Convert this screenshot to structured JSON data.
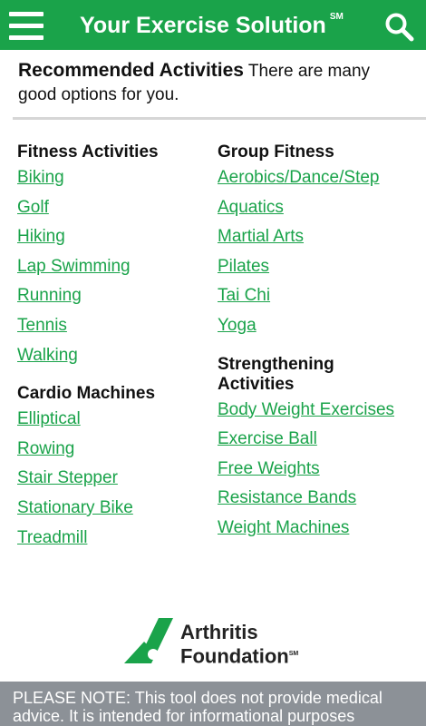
{
  "header": {
    "title": "Your Exercise Solution",
    "service_mark": "SM",
    "color": "#1aa34a"
  },
  "intro": {
    "heading": "Recommended Activities",
    "text": "There are many good options for you."
  },
  "left_column": [
    {
      "title": "Fitness Activities",
      "items": [
        "Biking",
        "Golf",
        "Hiking",
        "Lap Swimming",
        "Running",
        "Tennis",
        "Walking"
      ]
    },
    {
      "title": "Cardio Machines",
      "items": [
        "Elliptical",
        "Rowing",
        "Stair Stepper",
        "Stationary Bike",
        "Treadmill"
      ]
    }
  ],
  "right_column": [
    {
      "title": "Group Fitness",
      "items": [
        "Aerobics/Dance/Step",
        "Aquatics",
        "Martial Arts",
        "Pilates",
        "Tai Chi",
        "Yoga"
      ]
    },
    {
      "title": "Strengthening Activities",
      "items": [
        "Body Weight Exercises",
        "Exercise Ball",
        "Free Weights",
        "Resistance Bands",
        "Weight Machines"
      ]
    }
  ],
  "logo": {
    "line1": "Arthritis",
    "line2": "Foundation",
    "mark": "SM"
  },
  "notice": {
    "text": "PLEASE NOTE: This tool does not provide medical advice. It is intended for informational purposes"
  },
  "icons": {
    "menu": "hamburger-menu-icon",
    "search": "search-icon",
    "logo": "arthritis-foundation-logo-icon"
  },
  "colors": {
    "brand_green": "#1aa34a",
    "notice_gray": "#8c9197"
  }
}
